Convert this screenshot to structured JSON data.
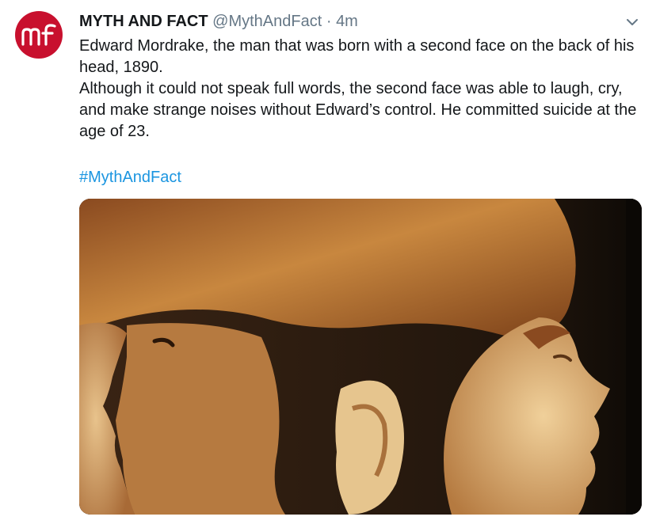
{
  "tweet": {
    "author_name": "MYTH AND FACT",
    "handle": "@MythAndFact",
    "separator": "·",
    "time": "4m",
    "text_line_1": "Edward Mordrake, the man that was born with a second face on the back of his head, 1890.",
    "text_line_2": "Although it could not speak full words, the second face was able to laugh, cry, and make strange noises without Edward’s control. He committed suicide at the age of 23.",
    "hashtag": "#MythAndFact"
  },
  "avatar": {
    "logo_text": "mf",
    "color": "#c8102e"
  },
  "icons": {
    "menu": "chevron-down-icon"
  },
  "colors": {
    "link": "#1b95e0",
    "secondary_text": "#657786",
    "primary_text": "#14171a"
  }
}
